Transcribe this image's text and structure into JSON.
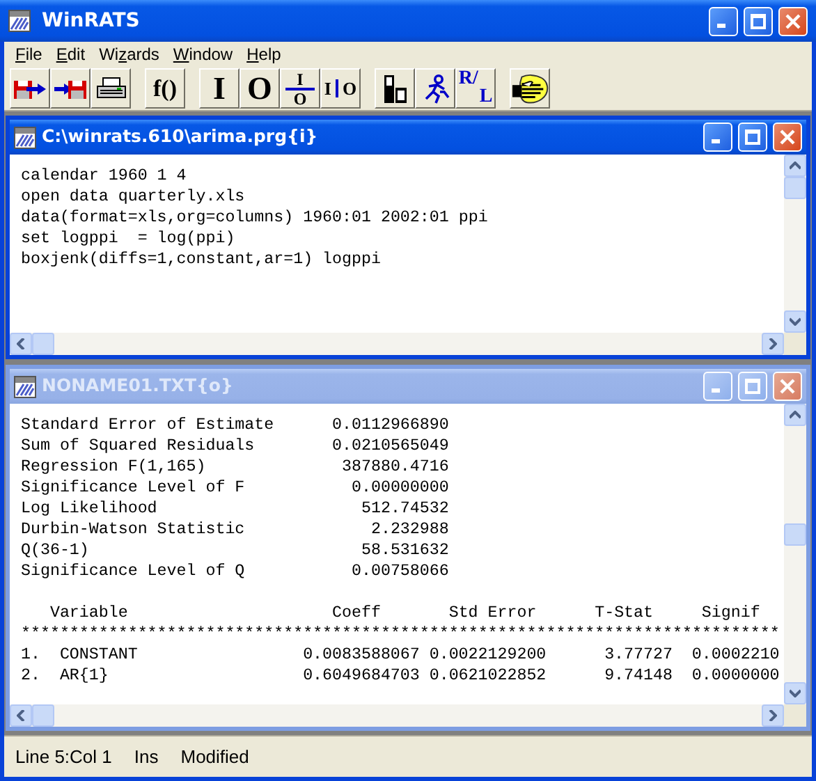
{
  "window": {
    "title": "WinRATS"
  },
  "menu": [
    {
      "key": "F",
      "post": "ile"
    },
    {
      "key": "E",
      "post": "dit"
    },
    {
      "pre": "Wi",
      "key": "z",
      "post": "ards"
    },
    {
      "key": "W",
      "post": "indow"
    },
    {
      "key": "H",
      "post": "elp"
    }
  ],
  "toolbar": [
    [
      {
        "kind": "icon"
      },
      {
        "kind": "icon"
      },
      {
        "kind": "icon"
      }
    ],
    [
      {
        "kind": "text",
        "label": "f()"
      }
    ],
    [
      {
        "kind": "text",
        "label": "I"
      },
      {
        "kind": "text",
        "label": "O"
      },
      {
        "kind": "fraction",
        "top": "I",
        "bottom": "O"
      },
      {
        "kind": "split",
        "left": "I",
        "right": "O"
      }
    ],
    [
      {
        "kind": "icon"
      },
      {
        "kind": "icon"
      },
      {
        "kind": "slash",
        "top": "R",
        "mid": "/",
        "bottom": "L"
      }
    ],
    [
      {
        "kind": "icon"
      }
    ]
  ],
  "editor": {
    "title": "C:\\winrats.610\\arima.prg{i}",
    "active": true,
    "lines": [
      "calendar 1960 1 4",
      "open data quarterly.xls",
      "data(format=xls,org=columns) 1960:01 2002:01 ppi",
      "set logppi  = log(ppi)",
      "boxjenk(diffs=1,constant,ar=1) logppi"
    ]
  },
  "output": {
    "title": "NONAME01.TXT{o}",
    "active": false,
    "stats": [
      {
        "label": "Standard Error of Estimate",
        "value": "0.0112966890"
      },
      {
        "label": "Sum of Squared Residuals",
        "value": "0.0210565049"
      },
      {
        "label": "Regression F(1,165)",
        "value": "387880.4716"
      },
      {
        "label": "Significance Level of F",
        "value": "0.00000000"
      },
      {
        "label": "Log Likelihood",
        "value": "512.74532"
      },
      {
        "label": "Durbin-Watson Statistic",
        "value": "2.232988"
      },
      {
        "label": "Q(36-1)",
        "value": "58.531632"
      },
      {
        "label": "Significance Level of Q",
        "value": "0.00758066"
      }
    ],
    "table": {
      "columns": [
        "Variable",
        "Coeff",
        "Std Error",
        "T-Stat",
        "Signif"
      ],
      "separator": "******************************************************************************",
      "rows": [
        {
          "number": "1.",
          "name": "CONSTANT",
          "values": [
            "0.0083588067",
            "0.0022129200",
            "3.77727",
            "0.0002210"
          ]
        },
        {
          "number": "2.",
          "name": "AR{1}",
          "values": [
            "0.6049684703",
            "0.0621022852",
            "9.74148",
            "0.0000000"
          ]
        }
      ]
    }
  },
  "status_bar": [
    "Line 5:Col 1",
    "Ins",
    "Modified"
  ]
}
